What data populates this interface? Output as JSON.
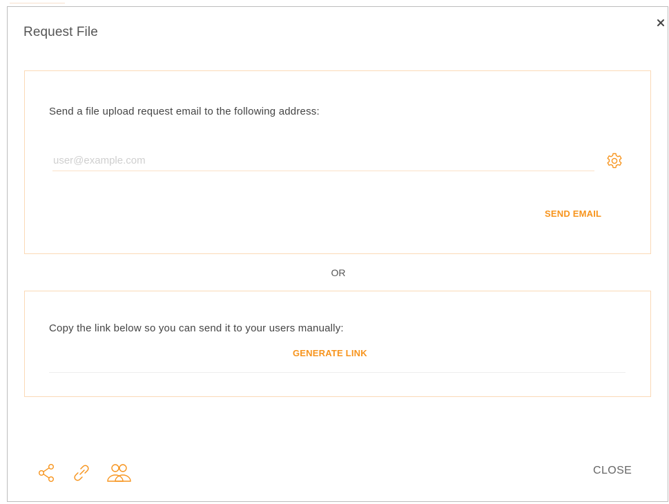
{
  "dialog": {
    "title": "Request File",
    "close_icon": "close-icon"
  },
  "email_section": {
    "instruction": "Send a file upload request email to the following address:",
    "email_value": "",
    "email_placeholder": "user@example.com",
    "settings_icon": "gear-icon",
    "send_label": "SEND EMAIL"
  },
  "separator": {
    "label": "OR"
  },
  "link_section": {
    "instruction": "Copy the link below so you can send it to your users manually:",
    "generate_label": "GENERATE LINK"
  },
  "footer": {
    "icons": [
      "share-icon",
      "link-icon",
      "users-icon"
    ],
    "close_label": "CLOSE"
  },
  "colors": {
    "accent": "#f7941d",
    "section_border": "#fbd9b6",
    "text": "#444444"
  }
}
